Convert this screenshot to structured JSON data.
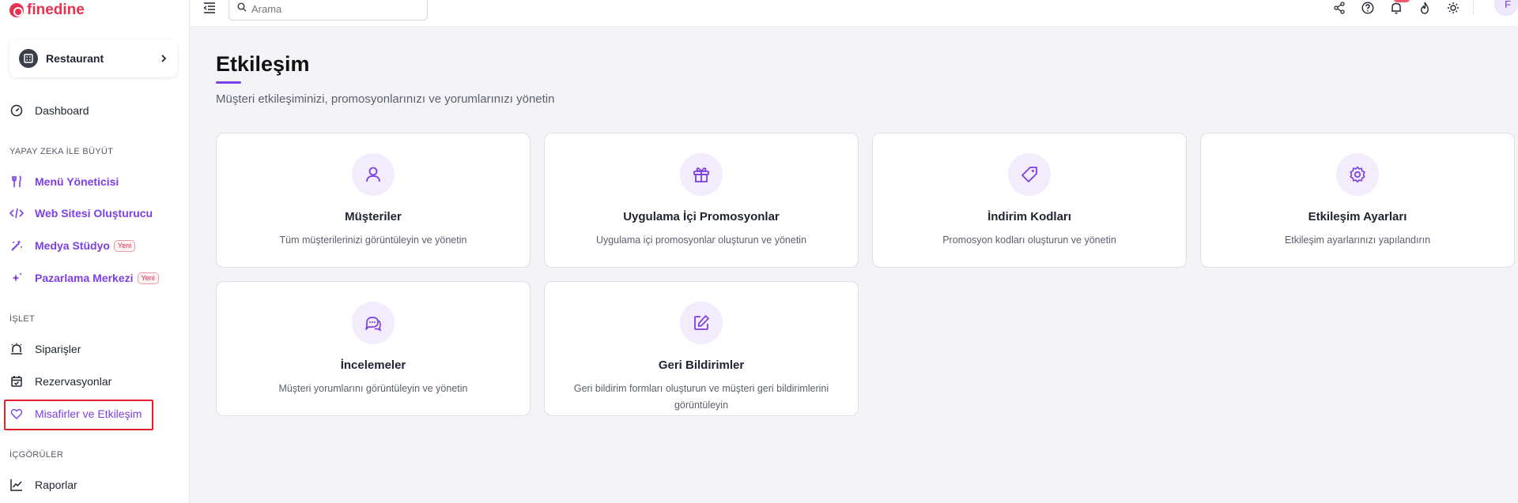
{
  "brand": {
    "name": "finedine",
    "color": "#e8314f",
    "accent": "#7b3fe4"
  },
  "sidebar": {
    "restaurant_label": "Restaurant",
    "dashboard": "Dashboard",
    "section_ai": "YAPAY ZEKA İLE BÜYÜT",
    "ai_items": [
      {
        "label": "Menü Yöneticisi",
        "icon": "utensils-icon"
      },
      {
        "label": "Web Sitesi Oluşturucu",
        "icon": "code-icon"
      },
      {
        "label": "Medya Stüdyo",
        "icon": "magic-wand-icon",
        "badge": "Yeni"
      },
      {
        "label": "Pazarlama Merkezi",
        "icon": "sparkles-icon",
        "badge": "Yeni"
      }
    ],
    "section_operate": "İŞLET",
    "operate_items": [
      {
        "label": "Siparişler",
        "icon": "bell-alarm-icon"
      },
      {
        "label": "Rezervasyonlar",
        "icon": "calendar-check-icon"
      },
      {
        "label": "Misafirler ve Etkileşim",
        "icon": "heart-icon",
        "active": true
      }
    ],
    "section_insights": "İÇGÖRÜLER",
    "insight_items": [
      {
        "label": "Raporlar",
        "icon": "line-chart-icon"
      }
    ]
  },
  "topbar": {
    "search_placeholder": "Arama",
    "icons": [
      "share-icon",
      "help-icon",
      "notification-icon",
      "fire-icon",
      "sun-icon"
    ],
    "avatar_initial": "F"
  },
  "page": {
    "title": "Etkileşim",
    "subtitle": "Müşteri etkileşiminizi, promosyonlarınızı ve yorumlarınızı yönetin"
  },
  "cards": [
    {
      "title": "Müşteriler",
      "description": "Tüm müşterilerinizi görüntüleyin ve yönetin",
      "icon": "user-icon"
    },
    {
      "title": "Uygulama İçi Promosyonlar",
      "description": "Uygulama içi promosyonlar oluşturun ve yönetin",
      "icon": "gift-icon"
    },
    {
      "title": "İndirim Kodları",
      "description": "Promosyon kodları oluşturun ve yönetin",
      "icon": "tag-icon"
    },
    {
      "title": "Etkileşim Ayarları",
      "description": "Etkileşim ayarlarınızı yapılandırın",
      "icon": "settings-icon"
    },
    {
      "title": "İncelemeler",
      "description": "Müşteri yorumlarını görüntüleyin ve yönetin",
      "icon": "chat-bubbles-icon"
    },
    {
      "title": "Geri Bildirimler",
      "description": "Geri bildirim formları oluşturun ve müşteri geri bildirimlerini görüntüleyin",
      "icon": "edit-icon"
    }
  ]
}
